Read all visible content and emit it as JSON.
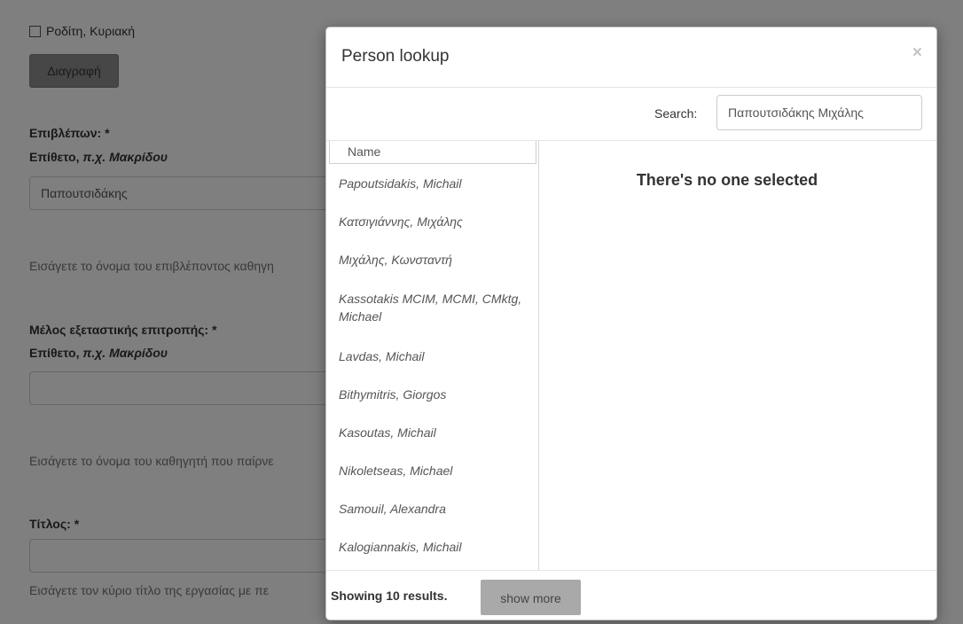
{
  "form": {
    "checkbox_label": "Ροδίτη, Κυριακή",
    "delete_label": "Διαγραφή",
    "supervisor": {
      "label": "Επιβλέπων: *",
      "sub_prefix": "Επίθετο, ",
      "sub_example": "π.χ. Μακρίδου",
      "value": "Παπουτσιδάκης",
      "help": "Εισάγετε το όνομα του επιβλέποντος καθηγη"
    },
    "committee": {
      "label": "Μέλος εξεταστικής επιτροπής: *",
      "sub_prefix": "Επίθετο, ",
      "sub_example": "π.χ. Μακρίδου",
      "value": "",
      "help": "Εισάγετε το όνομα του καθηγητή που παίρνε"
    },
    "title": {
      "label": "Τίτλος: *",
      "value": "",
      "help": "Εισάγετε τον κύριο τίτλο της εργασίας με πε"
    }
  },
  "modal": {
    "title": "Person lookup",
    "close_glyph": "×",
    "search_label": "Search:",
    "search_value": "Παπουτσιδάκης Μιχάλης",
    "column_header": "Name",
    "results": [
      "Papoutsidakis, Michail",
      "Κατσιγιάννης, Μιχάλης",
      "Μιχάλης, Κωνσταντή",
      "Kassotakis MCIM, MCMI, CMktg, Michael",
      "Lavdas, Michail",
      "Bithymitris, Giorgos",
      "Kasoutas, Michail",
      "Nikoletseas, Michael",
      "Samouil, Alexandra",
      "Kalogiannakis, Michail"
    ],
    "empty_message": "There's no one selected",
    "footer_count": "Showing 10 results.",
    "show_more_label": "show more"
  }
}
